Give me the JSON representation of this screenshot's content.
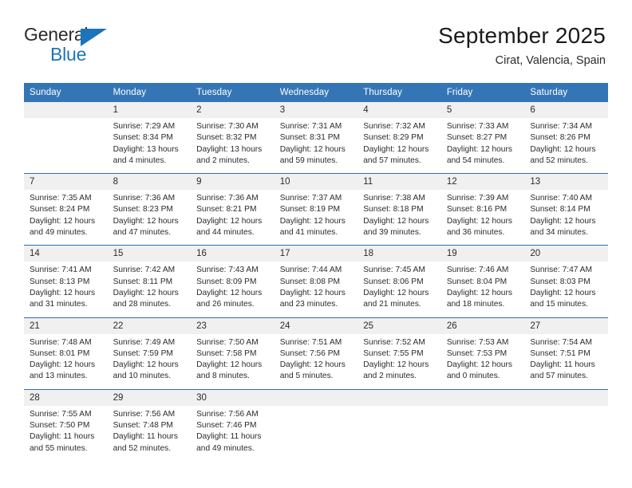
{
  "brand": {
    "name_top": "General",
    "name_bottom": "Blue",
    "triangle_color": "#1c74bb"
  },
  "header": {
    "title": "September 2025",
    "subtitle": "Cirat, Valencia, Spain"
  },
  "theme": {
    "header_blue": "#3476b5",
    "row_divider_blue": "#2f6fb0",
    "date_row_gray": "#f0f0f0"
  },
  "weekday_headers": [
    "Sunday",
    "Monday",
    "Tuesday",
    "Wednesday",
    "Thursday",
    "Friday",
    "Saturday"
  ],
  "weeks": [
    [
      {
        "day": "",
        "info": ""
      },
      {
        "day": "1",
        "info": "Sunrise: 7:29 AM\nSunset: 8:34 PM\nDaylight: 13 hours\nand 4 minutes."
      },
      {
        "day": "2",
        "info": "Sunrise: 7:30 AM\nSunset: 8:32 PM\nDaylight: 13 hours\nand 2 minutes."
      },
      {
        "day": "3",
        "info": "Sunrise: 7:31 AM\nSunset: 8:31 PM\nDaylight: 12 hours\nand 59 minutes."
      },
      {
        "day": "4",
        "info": "Sunrise: 7:32 AM\nSunset: 8:29 PM\nDaylight: 12 hours\nand 57 minutes."
      },
      {
        "day": "5",
        "info": "Sunrise: 7:33 AM\nSunset: 8:27 PM\nDaylight: 12 hours\nand 54 minutes."
      },
      {
        "day": "6",
        "info": "Sunrise: 7:34 AM\nSunset: 8:26 PM\nDaylight: 12 hours\nand 52 minutes."
      }
    ],
    [
      {
        "day": "7",
        "info": "Sunrise: 7:35 AM\nSunset: 8:24 PM\nDaylight: 12 hours\nand 49 minutes."
      },
      {
        "day": "8",
        "info": "Sunrise: 7:36 AM\nSunset: 8:23 PM\nDaylight: 12 hours\nand 47 minutes."
      },
      {
        "day": "9",
        "info": "Sunrise: 7:36 AM\nSunset: 8:21 PM\nDaylight: 12 hours\nand 44 minutes."
      },
      {
        "day": "10",
        "info": "Sunrise: 7:37 AM\nSunset: 8:19 PM\nDaylight: 12 hours\nand 41 minutes."
      },
      {
        "day": "11",
        "info": "Sunrise: 7:38 AM\nSunset: 8:18 PM\nDaylight: 12 hours\nand 39 minutes."
      },
      {
        "day": "12",
        "info": "Sunrise: 7:39 AM\nSunset: 8:16 PM\nDaylight: 12 hours\nand 36 minutes."
      },
      {
        "day": "13",
        "info": "Sunrise: 7:40 AM\nSunset: 8:14 PM\nDaylight: 12 hours\nand 34 minutes."
      }
    ],
    [
      {
        "day": "14",
        "info": "Sunrise: 7:41 AM\nSunset: 8:13 PM\nDaylight: 12 hours\nand 31 minutes."
      },
      {
        "day": "15",
        "info": "Sunrise: 7:42 AM\nSunset: 8:11 PM\nDaylight: 12 hours\nand 28 minutes."
      },
      {
        "day": "16",
        "info": "Sunrise: 7:43 AM\nSunset: 8:09 PM\nDaylight: 12 hours\nand 26 minutes."
      },
      {
        "day": "17",
        "info": "Sunrise: 7:44 AM\nSunset: 8:08 PM\nDaylight: 12 hours\nand 23 minutes."
      },
      {
        "day": "18",
        "info": "Sunrise: 7:45 AM\nSunset: 8:06 PM\nDaylight: 12 hours\nand 21 minutes."
      },
      {
        "day": "19",
        "info": "Sunrise: 7:46 AM\nSunset: 8:04 PM\nDaylight: 12 hours\nand 18 minutes."
      },
      {
        "day": "20",
        "info": "Sunrise: 7:47 AM\nSunset: 8:03 PM\nDaylight: 12 hours\nand 15 minutes."
      }
    ],
    [
      {
        "day": "21",
        "info": "Sunrise: 7:48 AM\nSunset: 8:01 PM\nDaylight: 12 hours\nand 13 minutes."
      },
      {
        "day": "22",
        "info": "Sunrise: 7:49 AM\nSunset: 7:59 PM\nDaylight: 12 hours\nand 10 minutes."
      },
      {
        "day": "23",
        "info": "Sunrise: 7:50 AM\nSunset: 7:58 PM\nDaylight: 12 hours\nand 8 minutes."
      },
      {
        "day": "24",
        "info": "Sunrise: 7:51 AM\nSunset: 7:56 PM\nDaylight: 12 hours\nand 5 minutes."
      },
      {
        "day": "25",
        "info": "Sunrise: 7:52 AM\nSunset: 7:55 PM\nDaylight: 12 hours\nand 2 minutes."
      },
      {
        "day": "26",
        "info": "Sunrise: 7:53 AM\nSunset: 7:53 PM\nDaylight: 12 hours\nand 0 minutes."
      },
      {
        "day": "27",
        "info": "Sunrise: 7:54 AM\nSunset: 7:51 PM\nDaylight: 11 hours\nand 57 minutes."
      }
    ],
    [
      {
        "day": "28",
        "info": "Sunrise: 7:55 AM\nSunset: 7:50 PM\nDaylight: 11 hours\nand 55 minutes."
      },
      {
        "day": "29",
        "info": "Sunrise: 7:56 AM\nSunset: 7:48 PM\nDaylight: 11 hours\nand 52 minutes."
      },
      {
        "day": "30",
        "info": "Sunrise: 7:56 AM\nSunset: 7:46 PM\nDaylight: 11 hours\nand 49 minutes."
      },
      {
        "day": "",
        "info": ""
      },
      {
        "day": "",
        "info": ""
      },
      {
        "day": "",
        "info": ""
      },
      {
        "day": "",
        "info": ""
      }
    ]
  ]
}
